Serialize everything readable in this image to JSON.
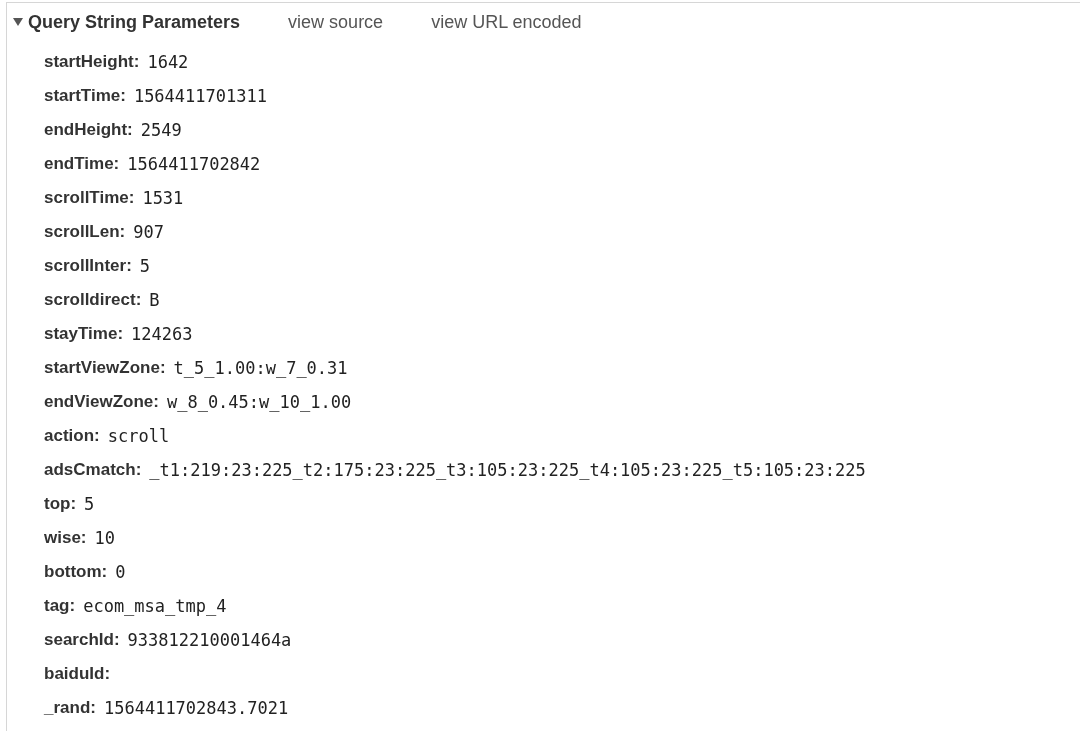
{
  "section": {
    "title": "Query String Parameters",
    "expanded": true,
    "links": [
      "view source",
      "view URL encoded"
    ]
  },
  "params": [
    {
      "key": "startHeight:",
      "value": "1642"
    },
    {
      "key": "startTime:",
      "value": "1564411701311"
    },
    {
      "key": "endHeight:",
      "value": "2549"
    },
    {
      "key": "endTime:",
      "value": "1564411702842"
    },
    {
      "key": "scrollTime:",
      "value": "1531"
    },
    {
      "key": "scrollLen:",
      "value": "907"
    },
    {
      "key": "scrollInter:",
      "value": "5"
    },
    {
      "key": "scrolldirect:",
      "value": "B"
    },
    {
      "key": "stayTime:",
      "value": "124263"
    },
    {
      "key": "startViewZone:",
      "value": "t_5_1.00:w_7_0.31"
    },
    {
      "key": "endViewZone:",
      "value": "w_8_0.45:w_10_1.00"
    },
    {
      "key": "action:",
      "value": "scroll"
    },
    {
      "key": "adsCmatch:",
      "value": "_t1:219:23:225_t2:175:23:225_t3:105:23:225_t4:105:23:225_t5:105:23:225"
    },
    {
      "key": "top:",
      "value": "5"
    },
    {
      "key": "wise:",
      "value": "10"
    },
    {
      "key": "bottom:",
      "value": "0"
    },
    {
      "key": "tag:",
      "value": "ecom_msa_tmp_4"
    },
    {
      "key": "searchId:",
      "value": "933812210001464a"
    },
    {
      "key": "baiduId:"
    },
    {
      "key": "_rand:",
      "value": "1564411702843.7021"
    }
  ]
}
